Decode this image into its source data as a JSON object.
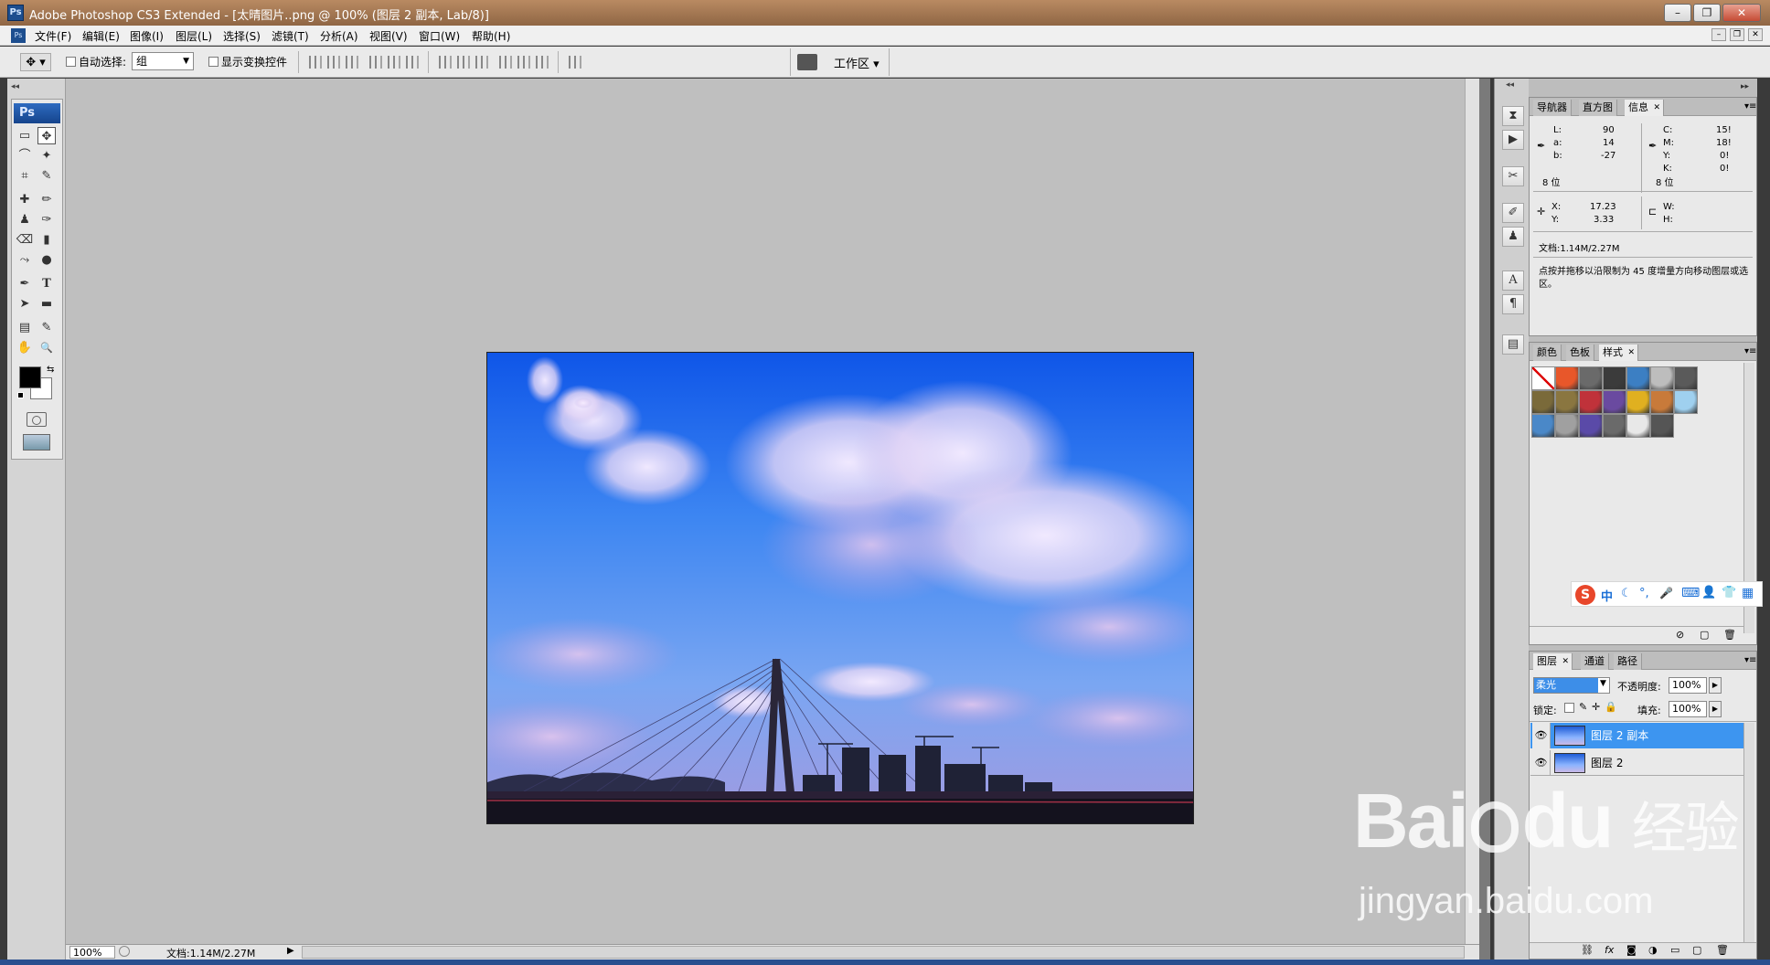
{
  "window": {
    "title": "Adobe Photoshop CS3 Extended - [太晴图片..png @ 100% (图层 2 副本, Lab/8)]",
    "app_icon": "Ps",
    "buttons": {
      "minimize": "–",
      "restore": "❐",
      "close": "✕"
    }
  },
  "menu": {
    "items": [
      "文件(F)",
      "编辑(E)",
      "图像(I)",
      "图层(L)",
      "选择(S)",
      "滤镜(T)",
      "分析(A)",
      "视图(V)",
      "窗口(W)",
      "帮助(H)"
    ],
    "mdi_buttons": [
      "–",
      "❐",
      "✕"
    ]
  },
  "options": {
    "auto_select_label": "自动选择:",
    "auto_select_value": "组",
    "show_transform_label": "显示变换控件",
    "workspace_label": "工作区 ▾"
  },
  "toolbox": {
    "logo": "Ps",
    "tools": [
      "▭",
      "✥",
      "⌒",
      "✦",
      "⌗",
      "✎",
      "✚",
      "✏",
      "♟",
      "✑",
      "⌫",
      "▮",
      "⤳",
      "●",
      "✒",
      "T",
      "➤",
      "▬",
      "▤",
      "✎",
      "✋",
      "🔍"
    ]
  },
  "document": {
    "scene": "sky-bridge"
  },
  "status": {
    "zoom": "100%",
    "doc_size": "文档:1.14M/2.27M"
  },
  "info_panel": {
    "tabs": [
      "导航器",
      "直方图",
      "信息"
    ],
    "lab": {
      "L_label": "L:",
      "L": "90",
      "a_label": "a:",
      "a": "14",
      "b_label": "b:",
      "b": "-27"
    },
    "cmyk": {
      "C_label": "C:",
      "C": "15!",
      "M_label": "M:",
      "M": "18!",
      "Y_label": "Y:",
      "Y": "0!",
      "K_label": "K:",
      "K": "0!"
    },
    "bits_left": "8 位",
    "bits_right": "8 位",
    "xy": {
      "X_label": "X:",
      "X": "17.23",
      "Y_label": "Y:",
      "Y": "3.33"
    },
    "wh": {
      "W_label": "W:",
      "H_label": "H:"
    },
    "doc_size": "文档:1.14M/2.27M",
    "hint": "点按并拖移以沿限制为 45 度增量方向移动图层或选区。"
  },
  "styles_panel": {
    "tabs": [
      "颜色",
      "色板",
      "样式"
    ],
    "swatches": [
      "#ffffff",
      "#e8572a",
      "#6a6a6a",
      "#3b3b3b",
      "#3c7fc3",
      "#bdbdbd",
      "#5a5a5a",
      "#7a6a3a",
      "#8a7640",
      "#c0323a",
      "#6a4aa0",
      "#e0b020",
      "#c87a3a",
      "#9fd0ef",
      "#4a88c8",
      "#a0a0a0",
      "#5a4aa8",
      "#6a6a6a",
      "#e8e8e8",
      "#555555"
    ]
  },
  "sogou": {
    "logo": "S",
    "items": [
      "中",
      "☾",
      "°,",
      "🎤",
      "⌨",
      "👤",
      "👕",
      "▦"
    ]
  },
  "layers_panel": {
    "tabs": [
      "图层",
      "通道",
      "路径"
    ],
    "blend_mode": "柔光",
    "opacity_label": "不透明度:",
    "opacity": "100%",
    "lock_label": "锁定:",
    "fill_label": "填充:",
    "fill": "100%",
    "layers": [
      {
        "name": "图层 2 副本",
        "selected": true
      },
      {
        "name": "图层 2",
        "selected": false
      }
    ],
    "footer_icons": [
      "link",
      "fx",
      "mask",
      "adjust",
      "group",
      "new",
      "trash"
    ]
  },
  "watermark": {
    "brand": "Bai",
    "brand2": "du",
    "jingyan": "经验",
    "url": "jingyan.baidu.com"
  }
}
